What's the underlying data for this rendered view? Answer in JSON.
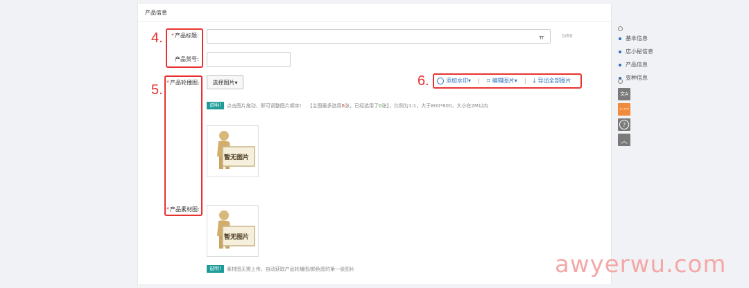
{
  "panel": {
    "title": "产品信息"
  },
  "annotations": {
    "a4": "4.",
    "a5": "5.",
    "a6": "6."
  },
  "fields": {
    "title_label": "产品标题:",
    "title_value": "",
    "title_counter": "0/60",
    "sku_label": "产品货号:",
    "sku_value": "",
    "carousel_label": "产品轮播图:",
    "material_label": "产品素材图:"
  },
  "carousel": {
    "select_button": "选择图片▾",
    "tools": {
      "watermark": "添加水印▾",
      "edit": "编辑图片▾",
      "export": "导出全部图片",
      "separator": "|"
    },
    "tip_badge": "说明!",
    "tip_a": "点击图片拖动，即可调整图片顺序!",
    "tip_b": "【主图最多选用",
    "tip_max": "6",
    "tip_c": "张，已经选用了",
    "tip_used": "0",
    "tip_d": "张】，比例为1:1，大于800*800，大小在2M以内",
    "placeholder": "暂无图片"
  },
  "material": {
    "placeholder": "暂无图片",
    "tip_badge": "说明!",
    "tip": "素材图无需上传，自动获取产品轮播图/颜色图的第一张图片"
  },
  "sidebar": {
    "items": [
      "基本信息",
      "店小秘信息",
      "产品信息",
      "变种信息"
    ],
    "buttons": {
      "translate": "文A",
      "calc": "+-×=",
      "help": "?",
      "top": "︿"
    }
  },
  "watermark_text": "awyerwu.com",
  "colors": {
    "accent": "#2c6fb7",
    "annotation": "#e8312f",
    "tip": "#1d9b98"
  }
}
